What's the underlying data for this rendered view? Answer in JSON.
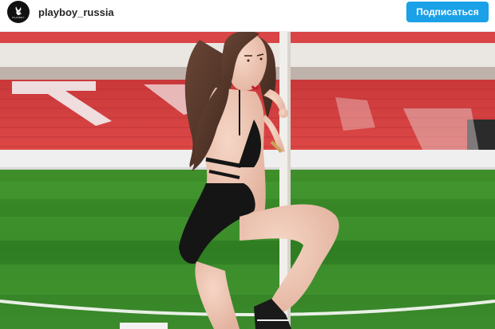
{
  "post_header": {
    "username": "playboy_russia",
    "avatar_icon": "playboy-bunny-logo",
    "avatar_text": "PLAYBOY",
    "follow_label": "Подписаться",
    "follow_color": "#1aa1e8"
  },
  "photo": {
    "icon": "photo-image",
    "scene": "stadium"
  }
}
